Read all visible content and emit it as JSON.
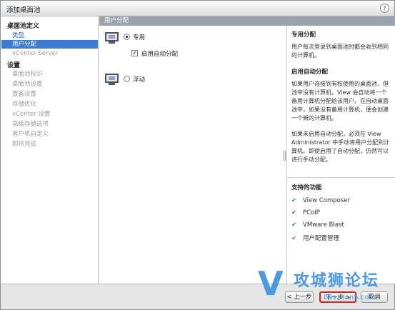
{
  "window": {
    "title": "添加桌面池",
    "help": "?"
  },
  "left_nav": {
    "section1": "桌面池定义",
    "items1": [
      {
        "label": "类型",
        "state": "link"
      },
      {
        "label": "用户分配",
        "state": "selected"
      },
      {
        "label": "vCenter Server",
        "state": "disabled"
      }
    ],
    "section2": "设置",
    "items2": [
      "桌面池标识",
      "桌面池设置",
      "置备设置",
      "存储优化",
      "vCenter 设置",
      "高级存储选项",
      "客户机自定义",
      "即将完成"
    ]
  },
  "center": {
    "header": "用户分配",
    "option_dedicated": "专用",
    "checkbox_auto": "启用自动分配",
    "checkbox_mark": "✓",
    "option_floating": "浮动"
  },
  "help_panel": {
    "title1": "专用分配",
    "text1": "用户每次登录到桌面池时都会收到相同的计算机。",
    "title2": "启用自动分配",
    "text2": "如果用户连接到有权使用的桌面池，但池中没有计算机，View 会自动将一个备用计算机分配给该用户。在自动桌面池中，如果没有备用计算机，便会创建一个新的计算机。",
    "text3": "如果未启用自动分配，必须在 View Administrator 中手动将用户分配到计算机。即使启用了自动分配，仍然可以进行手动分配。",
    "features_title": "支持的功能",
    "check_mark": "✔",
    "features": [
      "View Composer",
      "PCoIP",
      "VMware Blast",
      "用户配置管理"
    ]
  },
  "footer": {
    "prev": "< 上一步",
    "next": "下一步 >",
    "cancel": "取消"
  },
  "watermark": {
    "letter": "V",
    "text": "攻城狮论坛",
    "url": "bbs.vlan5.com"
  },
  "colors": {
    "accent": "#3a7bd5",
    "header": "#9aa3ad",
    "check": "#2e9b32",
    "highlight": "#e0201a"
  }
}
